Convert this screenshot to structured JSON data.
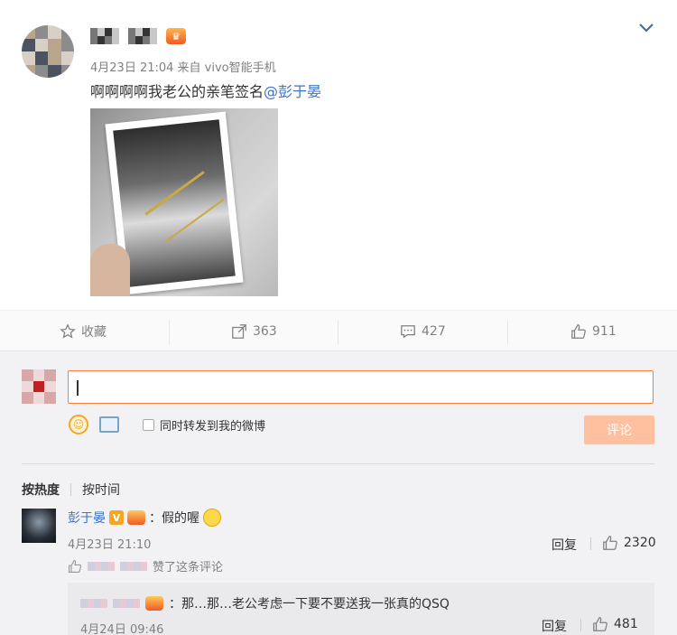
{
  "post": {
    "meta": "4月23日 21:04 来自 vivo智能手机",
    "text": "啊啊啊啊我老公的亲笔签名",
    "mention": "@彭于晏",
    "actions": {
      "favorite_label": "收藏",
      "repost_count": "363",
      "comment_count": "427",
      "like_count": "911"
    }
  },
  "compose": {
    "sync_label": "同时转发到我的微博",
    "submit_label": "评论"
  },
  "sort": {
    "hot_label": "按热度",
    "time_label": "按时间"
  },
  "comments": [
    {
      "author": "彭于晏",
      "text": "：假的喔",
      "time": "4月23日 21:10",
      "reply_label": "回复",
      "like_count": "2320",
      "liked_by_text": "赞了这条评论",
      "replies": [
        {
          "text": "：那…那…老公考虑一下要不要送我一张真的QSQ",
          "time": "4月24日 09:46",
          "reply_label": "回复",
          "like_count": "481"
        }
      ]
    }
  ],
  "colors": {
    "accent": "#fa7d3c",
    "link": "#3d73c4",
    "submit_disabled": "#ffc09f"
  },
  "icons": {
    "favorite": "star-icon",
    "repost": "repost-icon",
    "comment": "comment-icon",
    "like": "thumbs-up-icon",
    "more": "chevron-down-icon",
    "emoji": "emoji-icon",
    "image": "image-icon"
  }
}
